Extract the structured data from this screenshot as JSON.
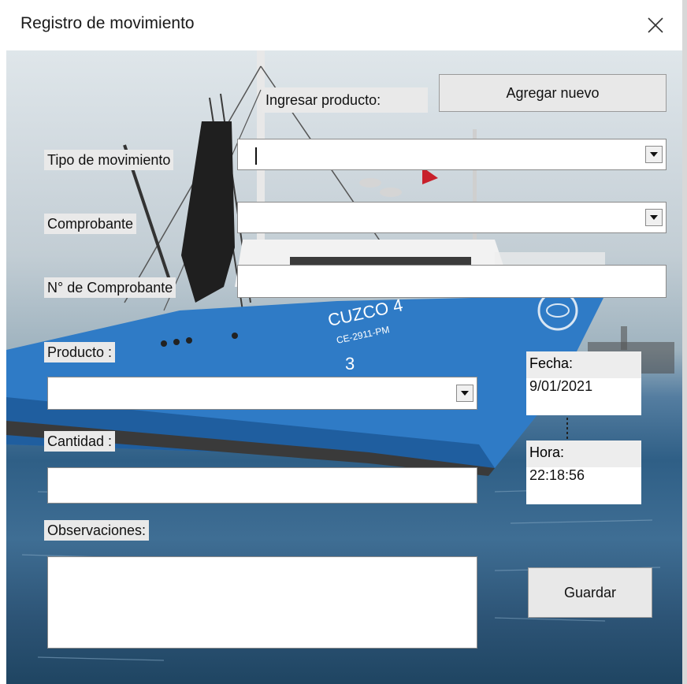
{
  "window": {
    "title": "Registro de movimiento",
    "close_icon": "close-icon"
  },
  "form": {
    "ingresar_label": "Ingresar producto:",
    "agregar_button": "Agregar nuevo",
    "tipo_label": "Tipo de movimiento",
    "tipo_value": "",
    "comprobante_label": "Comprobante",
    "comprobante_value": "",
    "nro_label": "N° de Comprobante",
    "nro_value": "",
    "producto_label": "Producto :",
    "producto_value": "",
    "cantidad_label": "Cantidad :",
    "cantidad_value": "",
    "observaciones_label": "Observaciones:",
    "observaciones_value": "",
    "fecha_label": "Fecha:",
    "fecha_value": "9/01/2021",
    "hora_label": "Hora:",
    "hora_value": "22:18:56",
    "guardar_button": "Guardar"
  },
  "background": {
    "ship_name": "CUZCO 4",
    "ship_reg": "CE-2911-PM",
    "hull_number": "3",
    "colors": {
      "hull": "#2f7bc6",
      "sea": "#3b6a90",
      "sky": "#d9e1e6"
    }
  }
}
